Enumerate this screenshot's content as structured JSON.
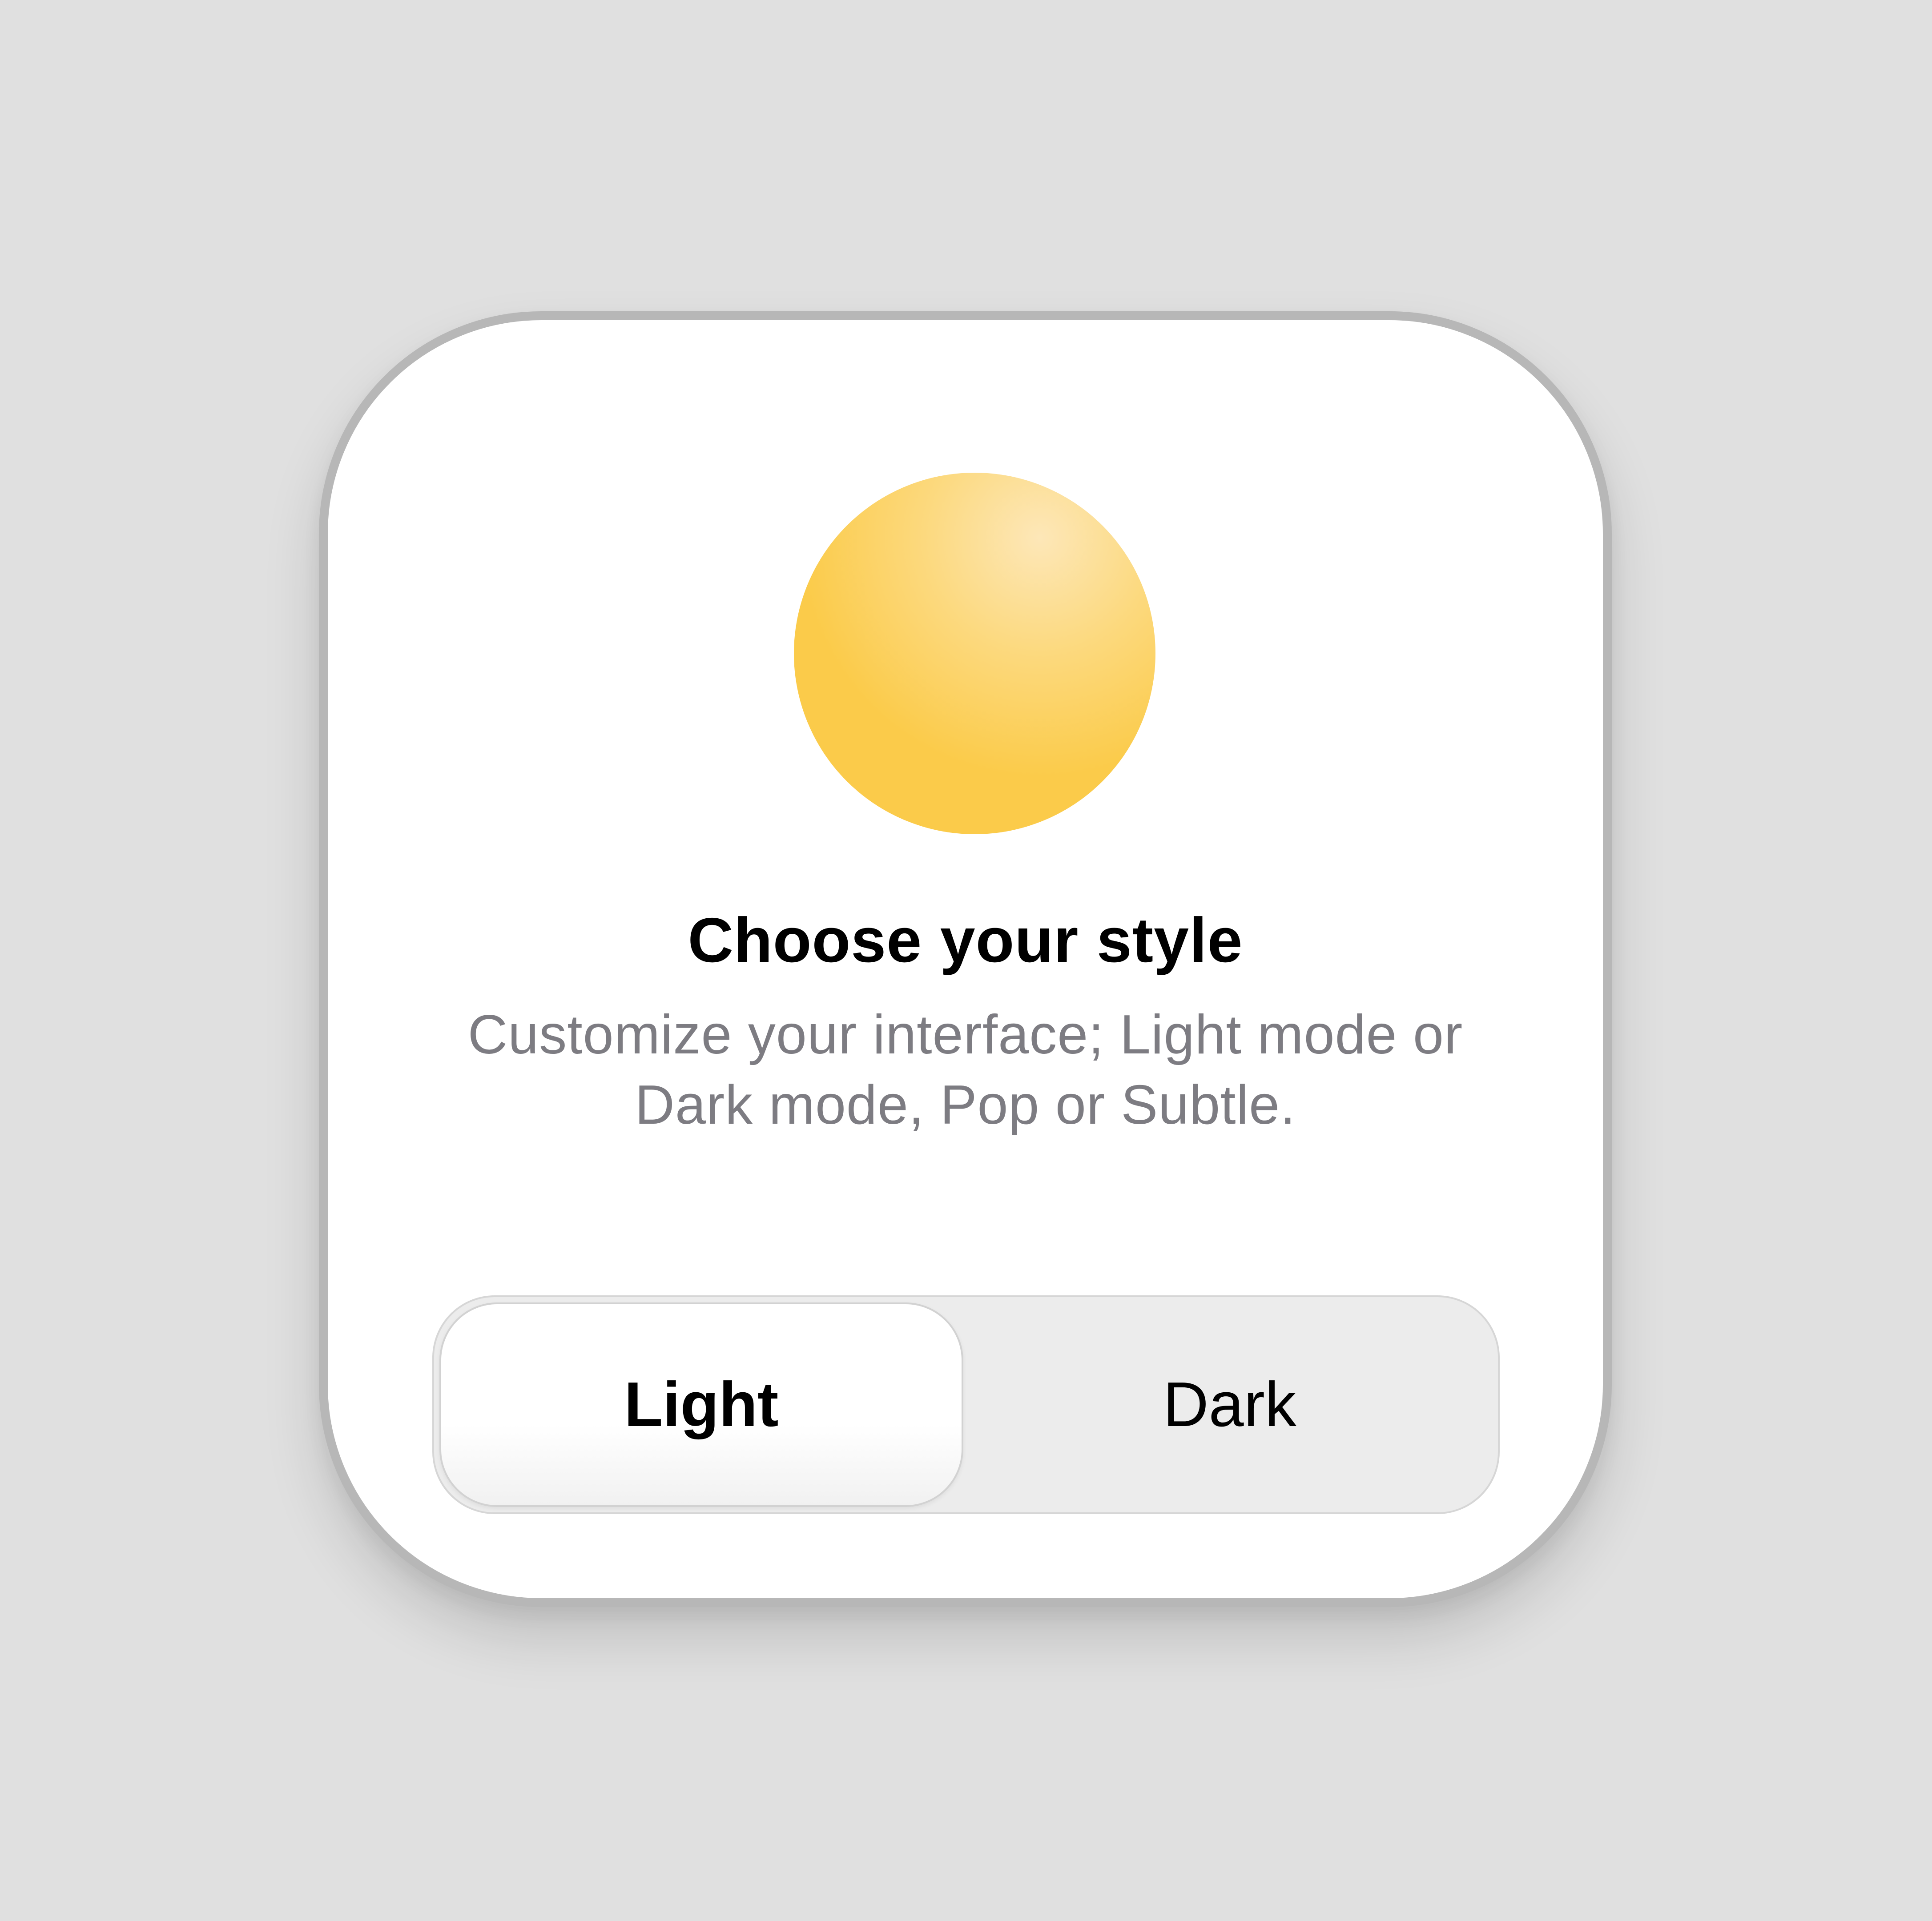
{
  "card": {
    "title": "Choose your style",
    "subtitle": "Customize your interface; Light mode or Dark mode, Pop or Subtle."
  },
  "theme_toggle": {
    "options": [
      {
        "label": "Light",
        "selected": true
      },
      {
        "label": "Dark",
        "selected": false
      }
    ]
  },
  "icons": {
    "hero": "sun-icon"
  },
  "colors": {
    "background": "#e0e0e0",
    "card": "#ffffff",
    "card_border": "#b7b7b7",
    "sun": "#fbcb4a",
    "subtitle": "#7d7c82",
    "segment_track": "#ececec"
  }
}
